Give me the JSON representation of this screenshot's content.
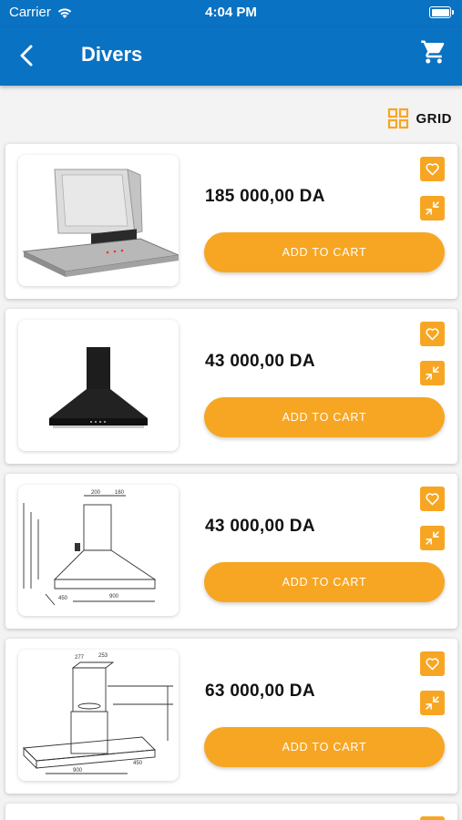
{
  "status_bar": {
    "carrier": "Carrier",
    "time": "4:04 PM"
  },
  "app_bar": {
    "title": "Divers",
    "back_icon": "chevron-left-icon",
    "cart_icon": "shopping-cart-icon",
    "background_color": "#0a72c2"
  },
  "view_toggle": {
    "label": "GRID",
    "icon": "grid-icon"
  },
  "colors": {
    "accent": "#f7a623",
    "brand_blue": "#0a72c2"
  },
  "products": [
    {
      "price": "185 000,00 DA",
      "add_to_cart_label": "ADD TO CART",
      "image": "range-hood-stainless-image"
    },
    {
      "price": "43 000,00 DA",
      "add_to_cart_label": "ADD TO CART",
      "image": "range-hood-black-image"
    },
    {
      "price": "43 000,00 DA",
      "add_to_cart_label": "ADD TO CART",
      "image": "range-hood-diagram-image"
    },
    {
      "price": "63 000,00 DA",
      "add_to_cart_label": "ADD TO CART",
      "image": "range-hood-island-diagram-image"
    }
  ]
}
